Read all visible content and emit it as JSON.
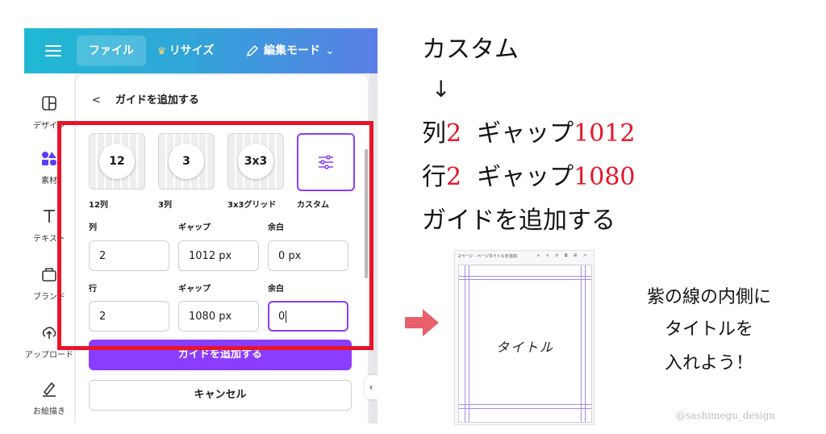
{
  "app": {
    "topbar": {
      "file_label": "ファイル",
      "resize_label": "リサイズ",
      "edit_mode_label": "編集モード"
    },
    "sidenav": [
      {
        "label": "デザイン",
        "icon": "layout-icon"
      },
      {
        "label": "素材",
        "icon": "elements-icon"
      },
      {
        "label": "テキスト",
        "icon": "text-icon"
      },
      {
        "label": "ブランド",
        "icon": "brand-icon"
      },
      {
        "label": "アップロード",
        "icon": "upload-icon"
      },
      {
        "label": "お絵描き",
        "icon": "draw-icon"
      }
    ],
    "panel": {
      "title": "ガイドを追加する",
      "presets": [
        {
          "value": "12",
          "label": "12列"
        },
        {
          "value": "3",
          "label": "3列"
        },
        {
          "value": "3x3",
          "label": "3x3グリッド"
        },
        {
          "value": "",
          "label": "カスタム"
        }
      ],
      "columns": {
        "label": "列",
        "gap_label": "ギャップ",
        "margin_label": "余白",
        "value": "2",
        "gap": "1012 px",
        "margin": "0 px"
      },
      "rows": {
        "label": "行",
        "gap_label": "ギャップ",
        "margin_label": "余白",
        "value": "2",
        "gap": "1080 px",
        "margin": "0"
      },
      "add_button": "ガイドを追加する",
      "cancel_button": "キャンセル"
    },
    "colors": {
      "accent": "#8b3dff",
      "highlight": "#e8142a"
    }
  },
  "instructions": {
    "line1": "カスタム",
    "arrow": "↓",
    "line3_prefix": "列",
    "line3_num": "2",
    "line3_mid": "ギャップ",
    "line3_val": "1012",
    "line4_prefix": "行",
    "line4_num": "2",
    "line4_mid": "ギャップ",
    "line4_val": "1080",
    "line5": "ガイドを追加する"
  },
  "thumbnail": {
    "bar_text": "2ページ - ページタイトルを追加",
    "bar_icons": "∧ ∨ ⊙ ⧉ ⊞ ↗",
    "title": "タイトル"
  },
  "note": {
    "line1": "紫の線の内側に",
    "line2": "タイトルを",
    "line3": "入れよう！"
  },
  "credit": "@sashimegu_design"
}
